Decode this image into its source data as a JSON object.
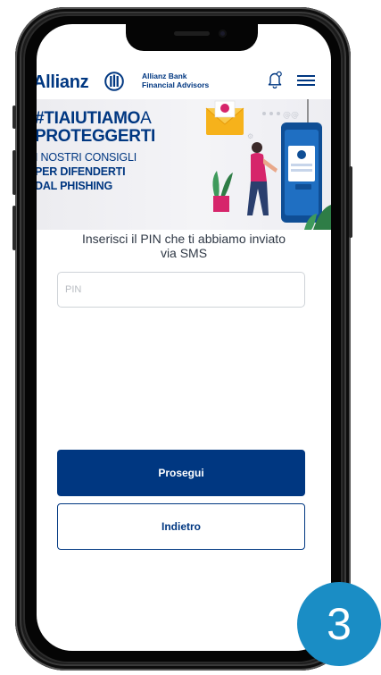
{
  "header": {
    "logo_text": "Allianz",
    "bank_name_line1": "Allianz Bank",
    "bank_name_line2": "Financial Advisors",
    "bell_icon": "notification-bell-icon",
    "menu_icon": "hamburger-menu-icon"
  },
  "banner": {
    "hashtag_ti": "#TI",
    "hashtag_aiutiamo": "AIUTIAMO",
    "hashtag_a": "A",
    "line2": "PROTEGGERTI",
    "line3": "I NOSTRI CONSIGLI",
    "line4": "PER DIFENDERTI",
    "line5": "DAL PHISHING"
  },
  "form": {
    "instruction_line1": "Inserisci il PIN che ti abbiamo inviato",
    "instruction_line2": "via SMS",
    "pin_placeholder": "PIN",
    "pin_value": "",
    "continue_label": "Prosegui",
    "back_label": "Indietro"
  },
  "step_badge": "3",
  "colors": {
    "brand": "#003781",
    "badge": "#1a8dc5"
  }
}
